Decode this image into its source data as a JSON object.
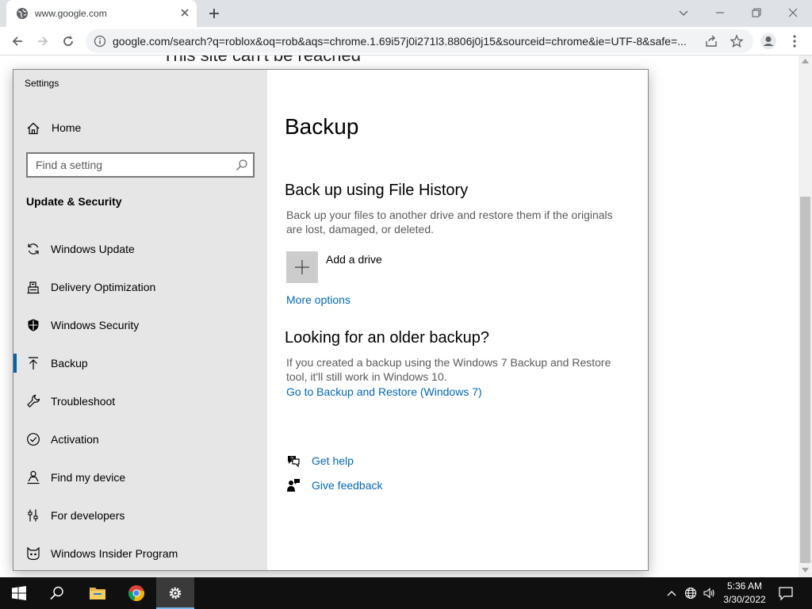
{
  "browser": {
    "tab_title": "www.google.com",
    "address_url": "google.com/search?q=roblox&oq=rob&aqs=chrome.1.69i57j0i271l3.8806j0j15&sourceid=chrome&ie=UTF-8&safe=...",
    "page_heading": "This site can't be reached"
  },
  "settings": {
    "window_title": "Settings",
    "home_label": "Home",
    "search_placeholder": "Find a setting",
    "section_title": "Update & Security",
    "nav_items": [
      {
        "label": "Windows Update",
        "icon": "sync-icon"
      },
      {
        "label": "Delivery Optimization",
        "icon": "delivery-optimization-icon"
      },
      {
        "label": "Windows Security",
        "icon": "shield-icon"
      },
      {
        "label": "Backup",
        "icon": "backup-arrow-icon",
        "selected": true
      },
      {
        "label": "Troubleshoot",
        "icon": "wrench-icon"
      },
      {
        "label": "Activation",
        "icon": "check-circle-icon"
      },
      {
        "label": "Find my device",
        "icon": "person-locate-icon"
      },
      {
        "label": "For developers",
        "icon": "developer-sliders-icon"
      },
      {
        "label": "Windows Insider Program",
        "icon": "insider-cat-icon"
      }
    ],
    "main": {
      "title": "Backup",
      "file_history_heading": "Back up using File History",
      "file_history_desc": "Back up your files to another drive and restore them if the originals are lost, damaged, or deleted.",
      "add_drive_label": "Add a drive",
      "more_options": "More options",
      "older_backup_heading": "Looking for an older backup?",
      "older_backup_desc": "If you created a backup using the Windows 7 Backup and Restore tool, it'll still work in Windows 10.",
      "backup_restore_link": "Go to Backup and Restore (Windows 7)",
      "get_help": "Get help",
      "give_feedback": "Give feedback"
    }
  },
  "taskbar": {
    "time": "5:36 AM",
    "date": "3/30/2022",
    "pinned": [
      "windows-start-icon",
      "search-icon",
      "file-explorer-icon",
      "chrome-icon",
      "settings-gear-icon"
    ]
  },
  "colors": {
    "accent": "#0063b1",
    "link": "#0067b8",
    "sidebar_bg": "#e6e6e6",
    "taskbar_bg": "#101010"
  }
}
